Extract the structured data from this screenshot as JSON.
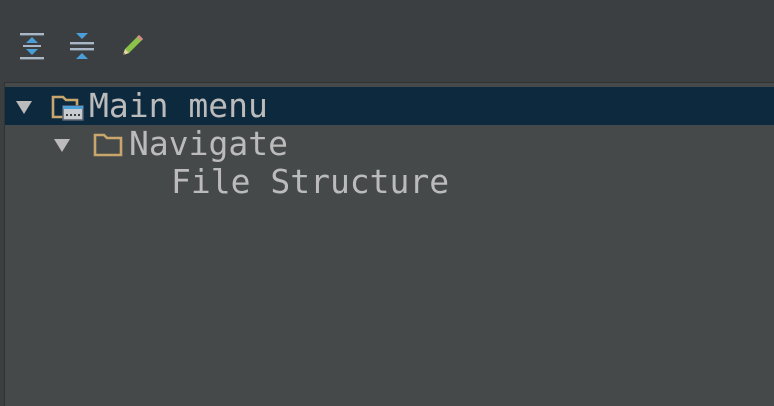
{
  "toolbar": {
    "buttons": [
      {
        "icon": "expand-all-icon"
      },
      {
        "icon": "collapse-all-icon"
      },
      {
        "icon": "edit-pencil-icon"
      }
    ]
  },
  "tree": {
    "items": [
      {
        "label": "Main menu",
        "expanded": true,
        "selected": true,
        "icon": "menu-folder-icon"
      },
      {
        "label": "Navigate",
        "expanded": true,
        "selected": false,
        "icon": "folder-icon"
      },
      {
        "label": "File Structure",
        "selected": false
      }
    ]
  },
  "colors": {
    "background": "#3c3f41",
    "tree_background": "#45494a",
    "selection": "#0d293e",
    "text": "#bbbbbb",
    "folder": "#c9a66b",
    "icon_blue": "#4a9fd8",
    "pencil": "#8bc34a"
  }
}
